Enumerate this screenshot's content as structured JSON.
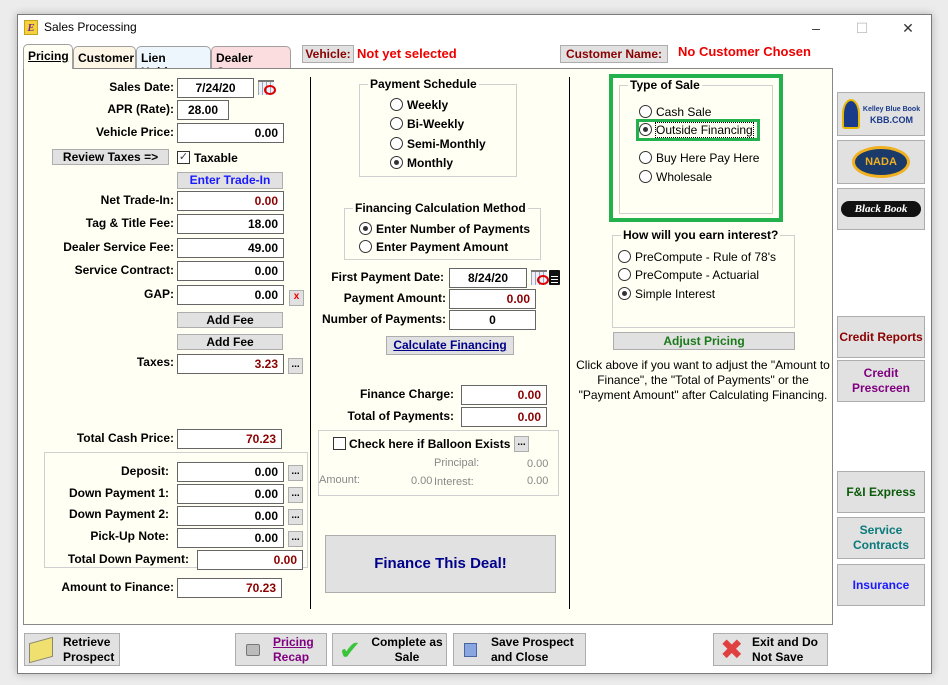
{
  "window": {
    "title": "Sales Processing",
    "minimize": "–",
    "maximize": "☐",
    "close": "✕"
  },
  "tabs": [
    {
      "label": "Pricing",
      "active": true,
      "color": "#fffff3"
    },
    {
      "label": "Customer",
      "color": "#fdf5e6"
    },
    {
      "label": "Lien Holder",
      "color": "#eef6fd"
    },
    {
      "label": "Dealer Costs",
      "color": "#fbdde0"
    }
  ],
  "header": {
    "vehicle_button": "Vehicle:",
    "vehicle_value": "Not yet selected",
    "customer_button": "Customer Name:",
    "customer_value": "No Customer Chosen"
  },
  "pricing": {
    "sales_date_label": "Sales Date:",
    "sales_date": "7/24/20",
    "apr_label": "APR (Rate):",
    "apr": "28.00",
    "vehicle_price_label": "Vehicle Price:",
    "vehicle_price": "0.00",
    "review_taxes_button": "Review Taxes =>",
    "taxable_label": "Taxable",
    "taxable_checked": true,
    "enter_tradein_button": "Enter Trade-In",
    "net_tradein_label": "Net Trade-In:",
    "net_tradein": "0.00",
    "tag_title_label": "Tag & Title Fee:",
    "tag_title": "18.00",
    "dealer_service_label": "Dealer Service Fee:",
    "dealer_service": "49.00",
    "service_contract_label": "Service Contract:",
    "service_contract": "0.00",
    "gap_label": "GAP:",
    "gap": "0.00",
    "gap_clear": "x",
    "add_fee_1": "Add Fee",
    "add_fee_2": "Add Fee",
    "taxes_label": "Taxes:",
    "taxes": "3.23",
    "ellipsis": "...",
    "total_cash_label": "Total Cash Price:",
    "total_cash": "70.23",
    "deposit_label": "Deposit:",
    "deposit": "0.00",
    "down1_label": "Down Payment 1:",
    "down1": "0.00",
    "down2_label": "Down Payment 2:",
    "down2": "0.00",
    "pickup_label": "Pick-Up Note:",
    "pickup": "0.00",
    "total_down_label": "Total Down Payment:",
    "total_down": "0.00",
    "amount_finance_label": "Amount to Finance:",
    "amount_finance": "70.23"
  },
  "schedule": {
    "title": "Payment Schedule",
    "options": [
      "Weekly",
      "Bi-Weekly",
      "Semi-Monthly",
      "Monthly"
    ],
    "selected": "Monthly"
  },
  "calc_method": {
    "title": "Financing Calculation Method",
    "options": [
      "Enter Number of Payments",
      "Enter Payment Amount"
    ],
    "selected": "Enter Number of Payments"
  },
  "financing": {
    "first_payment_label": "First Payment Date:",
    "first_payment": "8/24/20",
    "payment_amount_label": "Payment Amount:",
    "payment_amount": "0.00",
    "num_payments_label": "Number of Payments:",
    "num_payments": "0",
    "calculate_button": "Calculate Financing",
    "finance_charge_label": "Finance Charge:",
    "finance_charge": "0.00",
    "total_payments_label": "Total of Payments:",
    "total_payments": "0.00",
    "balloon_label": "Check here if Balloon Exists",
    "balloon_checked": false,
    "principal_label": "Principal:",
    "principal": "0.00",
    "amount_label": "Amount:",
    "amount": "0.00",
    "interest_label": "Interest:",
    "interest": "0.00",
    "finance_deal_button": "Finance This Deal!"
  },
  "sale_type": {
    "title": "Type of Sale",
    "options": [
      "Cash Sale",
      "Outside Financing",
      "Buy Here Pay Here",
      "Wholesale"
    ],
    "selected": "Outside Financing",
    "highlight_color": "#22b14c"
  },
  "interest": {
    "title": "How will you earn interest?",
    "options": [
      "PreCompute - Rule of 78's",
      "PreCompute - Actuarial",
      "Simple Interest"
    ],
    "selected": "Simple Interest",
    "adjust_button": "Adjust Pricing",
    "help_text": "Click above if you want to adjust the \"Amount to Finance\", the \"Total of Payments\" or the \"Payment Amount\" after Calculating Financing."
  },
  "side": {
    "kbb": "KBB.COM",
    "kbb_sub": "Kelley Blue Book",
    "nada": "NADA",
    "blackbook": "Black Book",
    "credit_reports": "Credit Reports",
    "credit_prescreen": "Credit Prescreen",
    "fi_express": "F&I Express",
    "service_contracts": "Service Contracts",
    "insurance": "Insurance"
  },
  "bottom": {
    "retrieve": "Retrieve Prospect",
    "recap_1": "Pricing",
    "recap_2": "Recap",
    "complete_1": "Complete as",
    "complete_2": "Sale",
    "save_1": "Save Prospect",
    "save_2": "and Close",
    "exit_1": "Exit and Do",
    "exit_2": "Not Save"
  }
}
